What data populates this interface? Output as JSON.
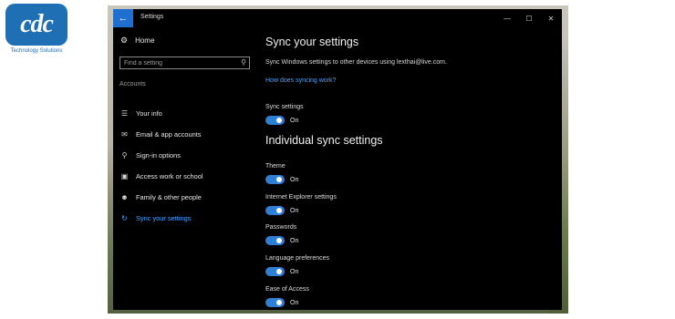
{
  "logo": {
    "mark": "cdc",
    "tagline": "Technology Solutions"
  },
  "window": {
    "title": "Settings",
    "controls": {
      "minimize": "—",
      "maximize": "☐",
      "close": "✕"
    }
  },
  "sidebar": {
    "home_label": "Home",
    "search_placeholder": "Find a setting",
    "section_label": "Accounts",
    "items": [
      {
        "label": "Your info",
        "icon": "person-card-icon"
      },
      {
        "label": "Email & app accounts",
        "icon": "mail-icon"
      },
      {
        "label": "Sign-in options",
        "icon": "key-icon"
      },
      {
        "label": "Access work or school",
        "icon": "briefcase-icon"
      },
      {
        "label": "Family & other people",
        "icon": "person-icon"
      },
      {
        "label": "Sync your settings",
        "icon": "sync-icon",
        "active": true
      }
    ]
  },
  "main": {
    "title": "Sync your settings",
    "description": "Sync Windows settings to other devices using lexthai@live.com.",
    "help_link": "How does syncing work?",
    "sync_settings": {
      "label": "Sync settings",
      "state": "On"
    },
    "individual_title": "Individual sync settings",
    "toggles": [
      {
        "label": "Theme",
        "state": "On"
      },
      {
        "label": "Internet Explorer settings",
        "state": "On"
      },
      {
        "label": "Passwords",
        "state": "On"
      },
      {
        "label": "Language preferences",
        "state": "On"
      },
      {
        "label": "Ease of Access",
        "state": "On"
      }
    ]
  },
  "colors": {
    "accent": "#2f7fd6",
    "link": "#4aa3ff",
    "window_bg": "#000000",
    "brand": "#1f6fb5"
  }
}
